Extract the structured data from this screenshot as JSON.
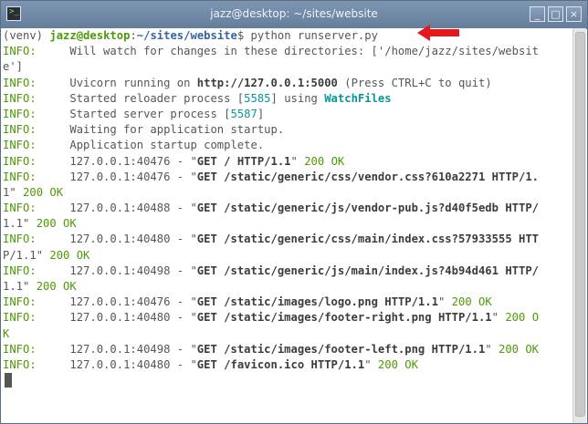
{
  "window": {
    "title": "jazz@desktop: ~/sites/website",
    "terminal_icon_glyph": ">_",
    "minimize_glyph": "_",
    "maximize_glyph": "□",
    "close_glyph": "×"
  },
  "terminal": {
    "prompt": {
      "venv": "(venv) ",
      "user_host": "jazz@desktop",
      "colon": ":",
      "path": "~/sites/website",
      "dollar": "$",
      "command": " python runserver.py"
    },
    "lines": [
      {
        "prefix": "INFO:",
        "text": "     Will watch for changes in these directories: ['/home/jazz/sites/websit"
      },
      {
        "prefix": "",
        "text": "e']"
      },
      {
        "prefix": "INFO:",
        "text": "     Uvicorn running on ",
        "url": "http://127.0.0.1:5000",
        "rest": " (Press CTRL+C to quit)"
      },
      {
        "prefix": "INFO:",
        "text": "     Started reloader process [",
        "pid": "5585",
        "mid": "] using ",
        "tool": "WatchFiles"
      },
      {
        "prefix": "INFO:",
        "text": "     Started server process [",
        "pid": "5587",
        "end": "]"
      },
      {
        "prefix": "INFO:",
        "text": "     Waiting for application startup."
      },
      {
        "prefix": "INFO:",
        "text": "     Application startup complete."
      },
      {
        "prefix": "INFO:",
        "text": "     127.0.0.1:40476 - \"",
        "req": "GET / HTTP/1.1",
        "close": "\" ",
        "status": "200 OK"
      },
      {
        "prefix": "INFO:",
        "text": "     127.0.0.1:40476 - \"",
        "req": "GET /static/generic/css/vendor.css?610a2271 HTTP/1."
      },
      {
        "prefix": "",
        "text": "1",
        "close": "\" ",
        "status": "200 OK"
      },
      {
        "prefix": "INFO:",
        "text": "     127.0.0.1:40488 - \"",
        "req": "GET /static/generic/js/vendor-pub.js?d40f5edb HTTP/"
      },
      {
        "prefix": "",
        "text": "1.1",
        "close": "\" ",
        "status": "200 OK"
      },
      {
        "prefix": "INFO:",
        "text": "     127.0.0.1:40480 - \"",
        "req": "GET /static/generic/css/main/index.css?57933555 HTT"
      },
      {
        "prefix": "",
        "text": "P/1.1",
        "close": "\" ",
        "status": "200 OK"
      },
      {
        "prefix": "INFO:",
        "text": "     127.0.0.1:40498 - \"",
        "req": "GET /static/generic/js/main/index.js?4b94d461 HTTP/"
      },
      {
        "prefix": "",
        "text": "1.1",
        "close": "\" ",
        "status": "200 OK"
      },
      {
        "prefix": "INFO:",
        "text": "     127.0.0.1:40476 - \"",
        "req": "GET /static/images/logo.png HTTP/1.1",
        "close": "\" ",
        "status": "200 OK"
      },
      {
        "prefix": "INFO:",
        "text": "     127.0.0.1:40480 - \"",
        "req": "GET /static/images/footer-right.png HTTP/1.1",
        "close": "\" ",
        "status": "200 O"
      },
      {
        "prefix": "",
        "text": "",
        "status": "K"
      },
      {
        "prefix": "INFO:",
        "text": "     127.0.0.1:40498 - \"",
        "req": "GET /static/images/footer-left.png HTTP/1.1",
        "close": "\" ",
        "status": "200 OK"
      },
      {
        "prefix": "INFO:",
        "text": "     127.0.0.1:40480 - \"",
        "req": "GET /favicon.ico HTTP/1.1",
        "close": "\" ",
        "status": "200 OK"
      }
    ]
  },
  "colors": {
    "titlebar": "#6e88a5",
    "info_green": "#4e9a06",
    "arrow_red": "#e3191c",
    "pid_cyan": "#06989a"
  }
}
